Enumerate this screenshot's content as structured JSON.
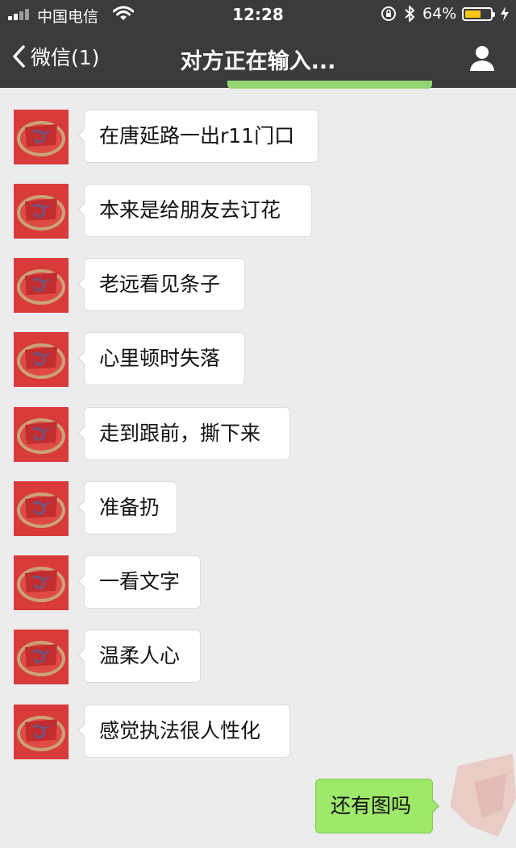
{
  "status_bar": {
    "carrier": "中国电信",
    "time": "12:28",
    "battery_percent": "64%",
    "battery_level": 0.64,
    "icons": [
      "signal-icon",
      "wifi-icon",
      "orientation-lock-icon",
      "bluetooth-icon",
      "battery-icon",
      "charging-icon"
    ]
  },
  "navbar": {
    "back_label": "微信(1)",
    "title": "对方正在输入...",
    "back_icon": "chevron-left-icon",
    "profile_icon": "person-icon"
  },
  "colors": {
    "navbar_bg": "#3b3b3d",
    "chat_bg": "#ececec",
    "incoming_bubble": "#ffffff",
    "outgoing_bubble": "#9ee86a",
    "avatar_bg": "#d93a3c"
  },
  "messages": [
    {
      "side": "incoming",
      "text": "在唐延路一出r11门口"
    },
    {
      "side": "incoming",
      "text": "本来是给朋友去订花"
    },
    {
      "side": "incoming",
      "text": "老远看见条子"
    },
    {
      "side": "incoming",
      "text": "心里顿时失落"
    },
    {
      "side": "incoming",
      "text": "走到跟前，撕下来"
    },
    {
      "side": "incoming",
      "text": "准备扔"
    },
    {
      "side": "incoming",
      "text": "一看文字"
    },
    {
      "side": "incoming",
      "text": "温柔人心"
    },
    {
      "side": "incoming",
      "text": "感觉执法很人性化"
    },
    {
      "side": "outgoing",
      "text": "还有图吗"
    }
  ]
}
